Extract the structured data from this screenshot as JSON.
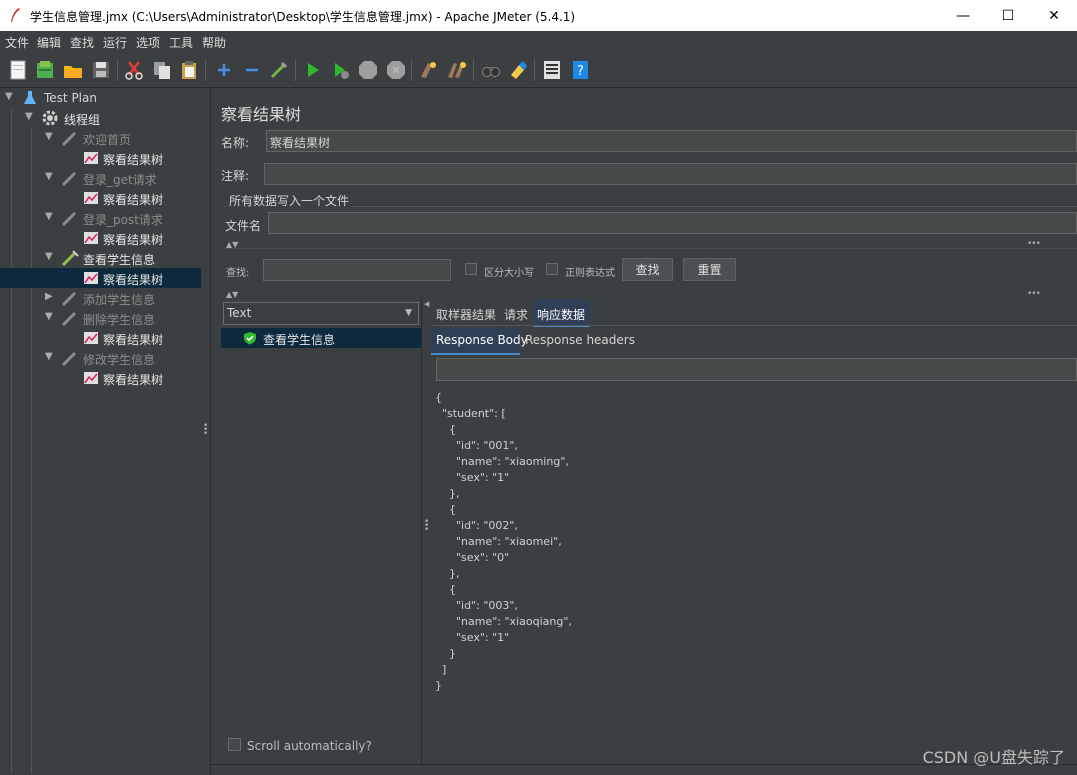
{
  "window": {
    "title": "学生信息管理.jmx (C:\\Users\\Administrator\\Desktop\\学生信息管理.jmx) - Apache JMeter (5.4.1)",
    "minimize": "—",
    "maximize": "☐",
    "close": "✕"
  },
  "menu": [
    "文件",
    "编辑",
    "查找",
    "运行",
    "选项",
    "工具",
    "帮助"
  ],
  "tree": {
    "test_plan": "Test Plan",
    "thread_group": "线程组",
    "items": [
      {
        "label": "欢迎首页",
        "child": "察看结果树"
      },
      {
        "label": "登录_get请求",
        "child": "察看结果树"
      },
      {
        "label": "登录_post请求",
        "child": "察看结果树"
      },
      {
        "label": "查看学生信息",
        "child": "察看结果树"
      },
      {
        "label": "添加学生信息"
      },
      {
        "label": "删除学生信息",
        "child": "察看结果树"
      },
      {
        "label": "修改学生信息",
        "child": "察看结果树"
      }
    ]
  },
  "panel": {
    "title": "察看结果树",
    "name_label": "名称:",
    "name_value": "察看结果树",
    "comment_label": "注释:",
    "comment_value": "",
    "file_section": "所有数据写入一个文件",
    "file_label": "文件名",
    "file_value": "",
    "search_label": "查找:",
    "case_label": "区分大小写",
    "regex_label": "正则表达式",
    "find_button": "查找",
    "reset_button": "重置",
    "renderer": "Text",
    "sample": "查看学生信息",
    "tabs": [
      "取样器结果",
      "请求",
      "响应数据"
    ],
    "subtabs": [
      "Response Body",
      "Response headers"
    ],
    "scroll_auto": "Scroll automatically?",
    "response_body": "{\n  \"student\": [\n    {\n      \"id\": \"001\",\n      \"name\": \"xiaoming\",\n      \"sex\": \"1\"\n    },\n    {\n      \"id\": \"002\",\n      \"name\": \"xiaomei\",\n      \"sex\": \"0\"\n    },\n    {\n      \"id\": \"003\",\n      \"name\": \"xiaoqiang\",\n      \"sex\": \"1\"\n    }\n  ]\n}"
  },
  "watermark": "CSDN @U盘失踪了",
  "colors": {
    "background": "#3c3f41",
    "selection": "#0d293e",
    "accent": "#4b6eaf"
  }
}
